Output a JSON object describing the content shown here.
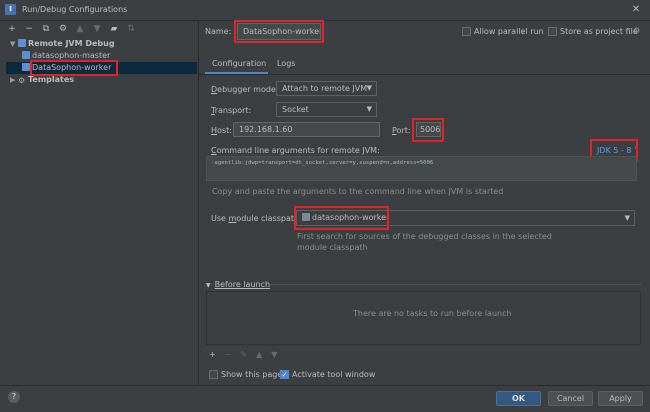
{
  "window": {
    "title": "Run/Debug Configurations",
    "close_glyph": "✕",
    "app_icon_glyph": "I"
  },
  "toolbar": {
    "add": "+",
    "remove": "−",
    "copy": "⧉",
    "settings": "⚙",
    "up": "▲",
    "down": "▼",
    "folder": "▰",
    "sort": "⇅"
  },
  "tree": {
    "group_remote": "Remote JVM Debug",
    "item_master": "datasophon-master",
    "item_worker": "DataSophon-worker",
    "group_templates": "Templates"
  },
  "form": {
    "name_label": "Name:",
    "name_value": "DataSophon-worker",
    "parallel_label": "Allow parallel run",
    "store_label": "Store as project file",
    "store_icon": "⚙"
  },
  "tabs": [
    "Configuration",
    "Logs"
  ],
  "config": {
    "debugger_mode_label": "Debugger mode:",
    "debugger_mode_value": "Attach to remote JVM",
    "transport_label": "Transport:",
    "transport_value": "Socket",
    "host_label": "Host:",
    "host_value": "192.168.1.60",
    "port_label": "Port:",
    "port_value": "5006",
    "cmd_label": "Command line arguments for remote JVM:",
    "jdk_value": "JDK 5 - 8",
    "cmd_value": "-agentlib:jdwp=transport=dt_socket,server=y,suspend=n,address=5006",
    "copy_hint": "Copy and paste the arguments to the command line when JVM is started",
    "module_label": "Use module classpath:",
    "module_value": "datasophon-worker",
    "module_hint_line1": "First search for sources of the debugged classes in the selected",
    "module_hint_line2": "module classpath"
  },
  "before_launch": {
    "label": "Before launch",
    "empty_text": "There are no tasks to run before launch",
    "tools": {
      "add": "+",
      "remove": "−",
      "edit": "✎",
      "up": "▲",
      "down": "▼"
    }
  },
  "footer": {
    "show_page_label": "Show this page",
    "activate_tool_label": "Activate tool window",
    "help": "?",
    "ok": "OK",
    "cancel": "Cancel",
    "apply": "Apply"
  },
  "colors": {
    "accent": "#4a88c7",
    "annotation_red": "#e0242b",
    "background": "#3c3f41",
    "primary_button": "#365880"
  }
}
